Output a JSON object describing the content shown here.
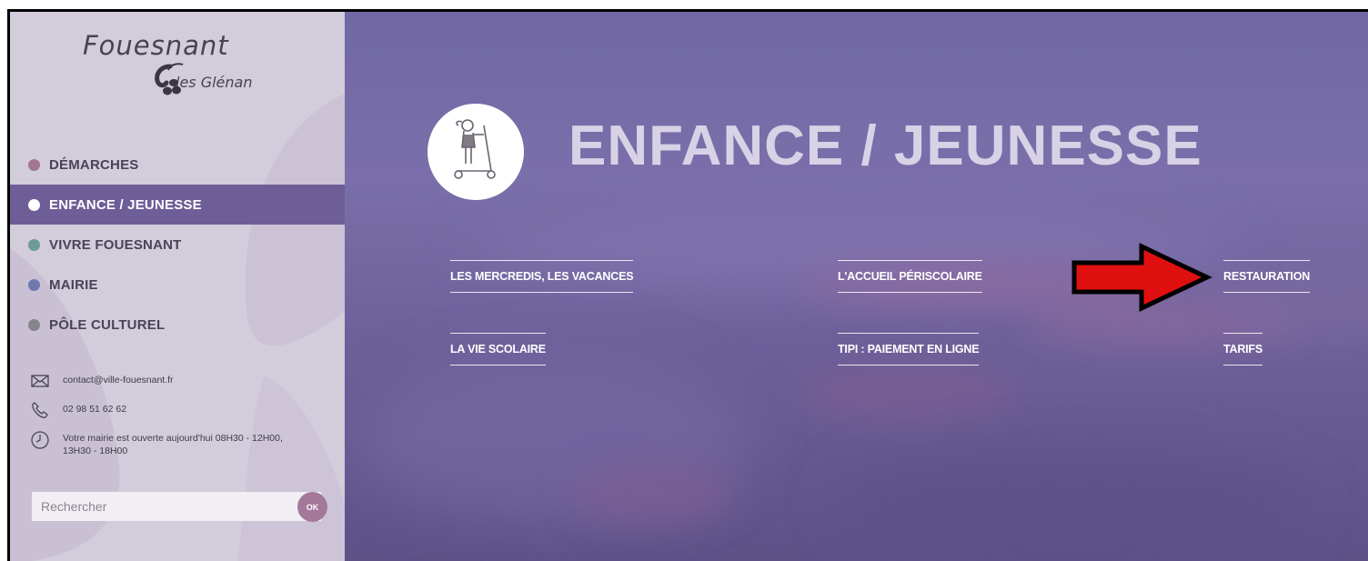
{
  "logo": {
    "name": "Fouesnant",
    "sub": "les Glénan"
  },
  "nav": {
    "items": [
      {
        "label": "DÉMARCHES",
        "color": "#a2778f"
      },
      {
        "label": "ENFANCE / JEUNESSE",
        "color": "#ffffff",
        "active": true
      },
      {
        "label": "VIVRE FOUESNANT",
        "color": "#6e9a99"
      },
      {
        "label": "MAIRIE",
        "color": "#6f79ae"
      },
      {
        "label": "PÔLE CULTUREL",
        "color": "#85848a"
      }
    ]
  },
  "contact": {
    "email": "contact@ville-fouesnant.fr",
    "phone": "02 98 51 62 62",
    "hours": "Votre mairie est ouverte aujourd'hui 08H30 - 12H00, 13H30 - 18H00"
  },
  "search": {
    "placeholder": "Rechercher",
    "button": "OK"
  },
  "hero": {
    "title": "ENFANCE / JEUNESSE",
    "icon": "child-scooter-icon",
    "links": [
      "LES MERCREDIS, LES VACANCES",
      "L'ACCUEIL PÉRISCOLAIRE",
      "RESTAURATION",
      "LA VIE SCOLAIRE",
      "TIPI : PAIEMENT EN LIGNE",
      "TARIFS"
    ]
  },
  "annotation": {
    "icon": "red-arrow-icon",
    "color": "#e01010"
  }
}
